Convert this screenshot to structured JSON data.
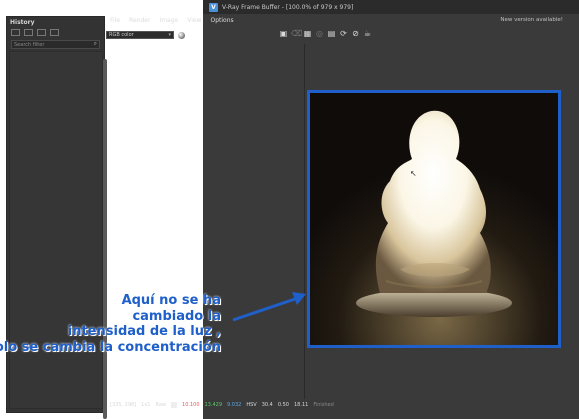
{
  "window": {
    "title": "V-Ray Frame Buffer - [100.0% of 979 x 979]",
    "app_icon_letter": "V"
  },
  "history": {
    "header": "History",
    "search_placeholder": "Search filter"
  },
  "menu": {
    "items": [
      "File",
      "Render",
      "Image",
      "View",
      "Options"
    ],
    "notice": "New version available!"
  },
  "toolbar": {
    "channel": "RGB color",
    "icons": [
      "save-icon",
      "clear-icon",
      "region-icon",
      "lens-icon",
      "camera-icon",
      "refresh-icon",
      "stop-render-icon",
      "teapot-icon"
    ]
  },
  "annotation": {
    "lines": [
      "Aquí no se ha",
      "cambiado la",
      "intensidad de la luz ,",
      "solo se cambia la concentración"
    ],
    "color": "#1f5fc9"
  },
  "statusbar": {
    "coords": "[335, 298]",
    "zoom": "1x1",
    "raw": "Raw",
    "r": "10.100",
    "g": "13.429",
    "b": "9.032",
    "mode": "HSV",
    "h": "30.4",
    "s": "0.50",
    "v": "18.11",
    "finished": "Finished"
  },
  "colors": {
    "frame_border": "#1f5fc9",
    "window_bg": "#3a3a3a"
  }
}
